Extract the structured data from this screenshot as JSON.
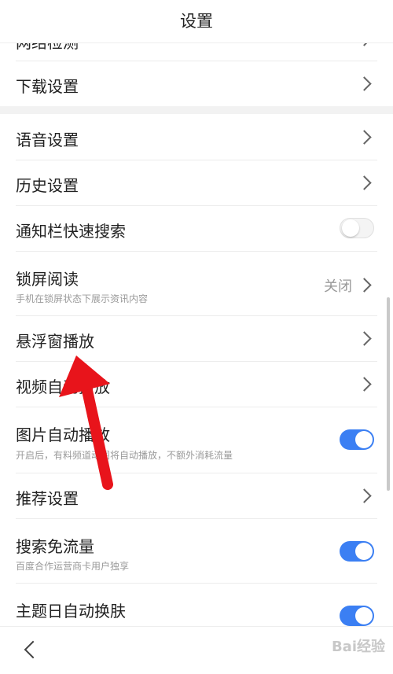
{
  "header": {
    "title": "设置"
  },
  "rows": [
    {
      "label": "网络检测"
    },
    {
      "label": "下载设置"
    },
    {
      "label": "语音设置"
    },
    {
      "label": "历史设置"
    },
    {
      "label": "通知栏快速搜索",
      "toggle": "off"
    },
    {
      "label": "锁屏阅读",
      "sub": "手机在锁屏状态下展示资讯内容",
      "value": "关闭"
    },
    {
      "label": "悬浮窗播放"
    },
    {
      "label": "视频自动播放"
    },
    {
      "label": "图片自动播放",
      "sub": "开启后，有料频道动图将自动播放，不额外消耗流量",
      "toggle": "on"
    },
    {
      "label": "推荐设置"
    },
    {
      "label": "搜索免流量",
      "sub": "百度合作运营商卡用户独享",
      "toggle": "on"
    },
    {
      "label": "主题日自动换肤",
      "toggle": "on"
    }
  ],
  "watermark": "Bai经验",
  "colors": {
    "accent": "#3b7ff3",
    "arrow": "#e8141b",
    "divider": "#f2f2f2"
  }
}
